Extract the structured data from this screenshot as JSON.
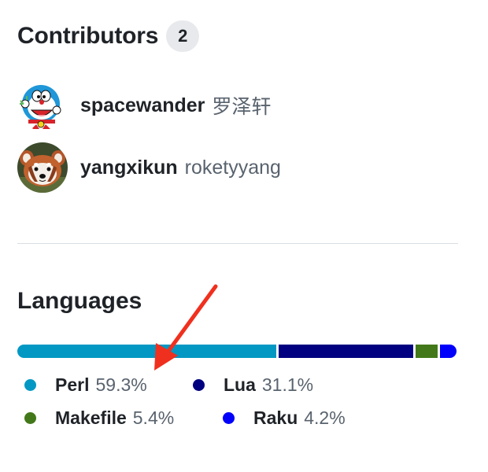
{
  "contributors": {
    "title": "Contributors",
    "count": "2",
    "people": [
      {
        "login": "spacewander",
        "name": "罗泽轩",
        "avatar": "doraemon-avatar"
      },
      {
        "login": "yangxikun",
        "name": "roketyyang",
        "avatar": "red-panda-avatar"
      }
    ]
  },
  "languages": {
    "title": "Languages",
    "items": [
      {
        "name": "Perl",
        "percent": "59.3%",
        "value": 59.3,
        "color": "#0298c3"
      },
      {
        "name": "Lua",
        "percent": "31.1%",
        "value": 31.1,
        "color": "#000080"
      },
      {
        "name": "Makefile",
        "percent": "5.4%",
        "value": 5.4,
        "color": "#427819"
      },
      {
        "name": "Raku",
        "percent": "4.2%",
        "value": 4.2,
        "color": "#0000fb"
      }
    ]
  },
  "annotation": {
    "arrow_color": "#f0301e",
    "icon": "red-arrow-icon"
  }
}
